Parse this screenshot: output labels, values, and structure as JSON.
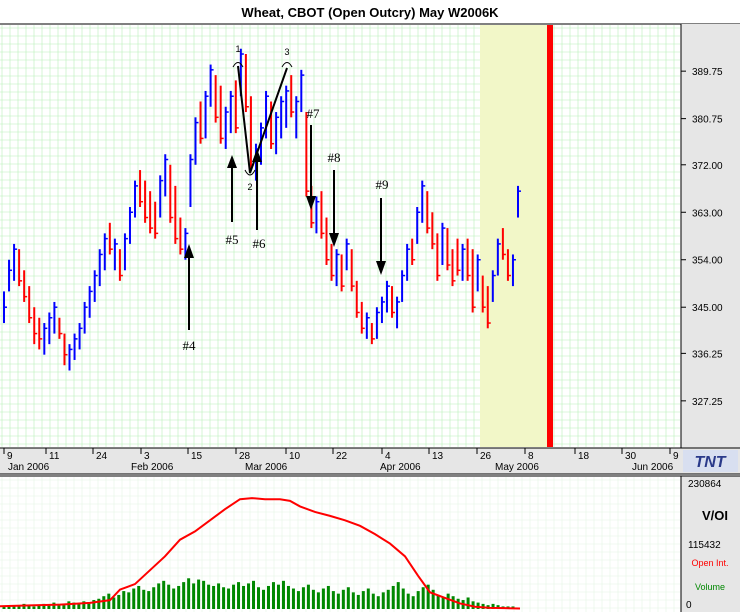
{
  "chart_data": [
    {
      "type": "ohlc",
      "title": "Wheat, CBOT (Open Outcry) May W2006K",
      "y_ticks": [
        "389.75",
        "380.75",
        "372.00",
        "363.00",
        "354.00",
        "345.00",
        "336.25",
        "327.25"
      ],
      "ylim": [
        318.5,
        398.5
      ],
      "grid": true,
      "colors": {
        "up": "#0000ff",
        "down": "#ff0000",
        "grid": "#b8f0b8",
        "marker": "#ff0000",
        "shade": "#f2f7c8"
      },
      "x_tick_labels": [
        "9",
        "11",
        "24",
        "3",
        "15",
        "28",
        "10",
        "22",
        "4",
        "13",
        "26",
        "8",
        "18",
        "30",
        "9"
      ],
      "month_labels": [
        "Jan 2006",
        "Feb 2006",
        "Mar 2006",
        "Apr 2006",
        "May 2006",
        "Jun 2006"
      ],
      "logo": "TNT",
      "annotations": [
        "1",
        "2",
        "3",
        "#4",
        "#5",
        "#6",
        "#7",
        "#8",
        "#9"
      ],
      "bars": [
        [
          348,
          342,
          345,
          "up"
        ],
        [
          354,
          348,
          352,
          "up"
        ],
        [
          357,
          350,
          356,
          "up"
        ],
        [
          356,
          349,
          350,
          "down"
        ],
        [
          352,
          346,
          347,
          "down"
        ],
        [
          349,
          342,
          343,
          "down"
        ],
        [
          345,
          338,
          340,
          "down"
        ],
        [
          343,
          337,
          339,
          "down"
        ],
        [
          342,
          336,
          341,
          "up"
        ],
        [
          344,
          338,
          343,
          "up"
        ],
        [
          346,
          340,
          345,
          "up"
        ],
        [
          343,
          339,
          340,
          "down"
        ],
        [
          340,
          334,
          336,
          "down"
        ],
        [
          338,
          333,
          337,
          "up"
        ],
        [
          340,
          335,
          339,
          "up"
        ],
        [
          342,
          337,
          341,
          "up"
        ],
        [
          346,
          340,
          345,
          "up"
        ],
        [
          349,
          343,
          348,
          "up"
        ],
        [
          352,
          346,
          351,
          "up"
        ],
        [
          356,
          349,
          355,
          "up"
        ],
        [
          359,
          352,
          358,
          "up"
        ],
        [
          361,
          355,
          356,
          "down"
        ],
        [
          358,
          352,
          357,
          "up"
        ],
        [
          356,
          350,
          351,
          "down"
        ],
        [
          359,
          352,
          358,
          "up"
        ],
        [
          364,
          357,
          363,
          "up"
        ],
        [
          369,
          362,
          368,
          "up"
        ],
        [
          371,
          364,
          365,
          "down"
        ],
        [
          369,
          361,
          362,
          "down"
        ],
        [
          367,
          359,
          360,
          "down"
        ],
        [
          365,
          358,
          359,
          "down"
        ],
        [
          370,
          362,
          369,
          "up"
        ],
        [
          374,
          366,
          373,
          "up"
        ],
        [
          372,
          361,
          362,
          "down"
        ],
        [
          368,
          357,
          358,
          "down"
        ],
        [
          362,
          355,
          356,
          "down"
        ],
        [
          360,
          354,
          359,
          "up"
        ],
        [
          374,
          364,
          373,
          "up"
        ],
        [
          381,
          372,
          380,
          "up"
        ],
        [
          384,
          376,
          377,
          "down"
        ],
        [
          386,
          377,
          385,
          "up"
        ],
        [
          391,
          383,
          390,
          "up"
        ],
        [
          389,
          380,
          381,
          "down"
        ],
        [
          387,
          376,
          377,
          "down"
        ],
        [
          383,
          375,
          382,
          "up"
        ],
        [
          386,
          378,
          385,
          "up"
        ],
        [
          388,
          378,
          379,
          "down"
        ],
        [
          394,
          385,
          393,
          "up"
        ],
        [
          393,
          382,
          383,
          "down"
        ],
        [
          385,
          371,
          372,
          "down"
        ],
        [
          376,
          369,
          375,
          "up"
        ],
        [
          380,
          372,
          379,
          "up"
        ],
        [
          386,
          377,
          385,
          "up"
        ],
        [
          384,
          375,
          376,
          "down"
        ],
        [
          382,
          374,
          381,
          "up"
        ],
        [
          385,
          377,
          384,
          "up"
        ],
        [
          387,
          379,
          386,
          "up"
        ],
        [
          389,
          381,
          382,
          "down"
        ],
        [
          385,
          377,
          384,
          "up"
        ],
        [
          390,
          382,
          389,
          "up"
        ],
        [
          382,
          366,
          367,
          "down"
        ],
        [
          368,
          360,
          361,
          "down"
        ],
        [
          366,
          359,
          365,
          "up"
        ],
        [
          367,
          358,
          359,
          "down"
        ],
        [
          362,
          353,
          354,
          "down"
        ],
        [
          357,
          350,
          351,
          "down"
        ],
        [
          356,
          349,
          355,
          "up"
        ],
        [
          355,
          348,
          349,
          "down"
        ],
        [
          358,
          352,
          357,
          "up"
        ],
        [
          356,
          348,
          349,
          "down"
        ],
        [
          350,
          343,
          344,
          "down"
        ],
        [
          346,
          340,
          341,
          "down"
        ],
        [
          344,
          339,
          343,
          "up"
        ],
        [
          342,
          338,
          339,
          "down"
        ],
        [
          345,
          339,
          344,
          "up"
        ],
        [
          347,
          342,
          346,
          "up"
        ],
        [
          350,
          344,
          349,
          "up"
        ],
        [
          349,
          343,
          344,
          "down"
        ],
        [
          347,
          341,
          346,
          "up"
        ],
        [
          352,
          346,
          351,
          "up"
        ],
        [
          357,
          350,
          356,
          "up"
        ],
        [
          358,
          353,
          354,
          "down"
        ],
        [
          364,
          357,
          363,
          "up"
        ],
        [
          369,
          361,
          368,
          "up"
        ],
        [
          367,
          359,
          360,
          "down"
        ],
        [
          363,
          356,
          357,
          "down"
        ],
        [
          359,
          350,
          351,
          "down"
        ],
        [
          361,
          353,
          360,
          "up"
        ],
        [
          360,
          352,
          353,
          "down"
        ],
        [
          356,
          349,
          350,
          "down"
        ],
        [
          358,
          351,
          352,
          "down"
        ],
        [
          357,
          350,
          356,
          "up"
        ],
        [
          358,
          350,
          351,
          "down"
        ],
        [
          356,
          344,
          345,
          "down"
        ],
        [
          355,
          348,
          354,
          "up"
        ],
        [
          351,
          344,
          345,
          "down"
        ],
        [
          349,
          341,
          342,
          "down"
        ],
        [
          352,
          346,
          351,
          "up"
        ],
        [
          358,
          351,
          357,
          "up"
        ],
        [
          360,
          354,
          355,
          "down"
        ],
        [
          356,
          350,
          351,
          "down"
        ],
        [
          355,
          349,
          354,
          "up"
        ],
        [
          368,
          362,
          367,
          "up"
        ]
      ]
    },
    {
      "type": "area",
      "y_ticks": [
        "230864",
        "115432",
        "0"
      ],
      "ylim": [
        0,
        230864
      ],
      "labels": {
        "main": "V/OI",
        "open_interest": "Open Int.",
        "volume": "Volume"
      },
      "colors": {
        "open_interest": "#ff0000",
        "volume": "#008800"
      },
      "open_interest": [
        [
          0,
          5000
        ],
        [
          30,
          6500
        ],
        [
          60,
          8000
        ],
        [
          90,
          11000
        ],
        [
          110,
          16000
        ],
        [
          120,
          35000
        ],
        [
          135,
          45000
        ],
        [
          150,
          70000
        ],
        [
          165,
          95000
        ],
        [
          180,
          125000
        ],
        [
          195,
          140000
        ],
        [
          210,
          160000
        ],
        [
          225,
          180000
        ],
        [
          240,
          198000
        ],
        [
          252,
          200000
        ],
        [
          265,
          198000
        ],
        [
          280,
          198000
        ],
        [
          290,
          195000
        ],
        [
          300,
          185000
        ],
        [
          315,
          175000
        ],
        [
          330,
          168000
        ],
        [
          345,
          160000
        ],
        [
          360,
          150000
        ],
        [
          375,
          135000
        ],
        [
          390,
          118000
        ],
        [
          405,
          95000
        ],
        [
          418,
          60000
        ],
        [
          430,
          30000
        ],
        [
          445,
          20000
        ],
        [
          460,
          10000
        ],
        [
          475,
          4000
        ],
        [
          490,
          2000
        ],
        [
          505,
          1500
        ],
        [
          520,
          1000
        ]
      ],
      "volume": [
        2,
        2,
        3,
        2,
        4,
        3,
        2,
        3,
        4,
        3,
        5,
        4,
        3,
        6,
        5,
        4,
        6,
        5,
        7,
        8,
        10,
        12,
        9,
        11,
        14,
        13,
        16,
        18,
        15,
        14,
        17,
        20,
        22,
        19,
        16,
        18,
        21,
        24,
        20,
        23,
        22,
        19,
        18,
        20,
        17,
        16,
        19,
        21,
        18,
        20,
        22,
        17,
        15,
        18,
        21,
        19,
        22,
        18,
        16,
        14,
        17,
        19,
        15,
        13,
        16,
        18,
        14,
        12,
        15,
        17,
        13,
        11,
        14,
        16,
        12,
        10,
        13,
        15,
        18,
        21,
        16,
        12,
        10,
        14,
        17,
        19,
        15,
        11,
        9,
        12,
        10,
        8,
        7,
        9,
        6,
        5,
        4,
        3,
        4,
        3,
        2,
        2,
        2,
        1
      ]
    }
  ]
}
